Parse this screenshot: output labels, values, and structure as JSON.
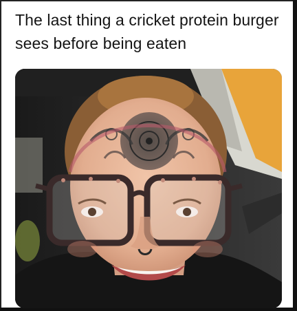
{
  "post": {
    "caption": "The last thing a cricket protein burger sees before being eaten"
  },
  "photo": {
    "subject": "selfie-in-car",
    "colors": {
      "window_yellow": "#e8a43a",
      "car_interior": "#1e1e1e",
      "skin": "#e6b49a",
      "hair": "#a8743e",
      "glasses_frame": "#3a2a2a",
      "jacket": "#151515"
    }
  }
}
